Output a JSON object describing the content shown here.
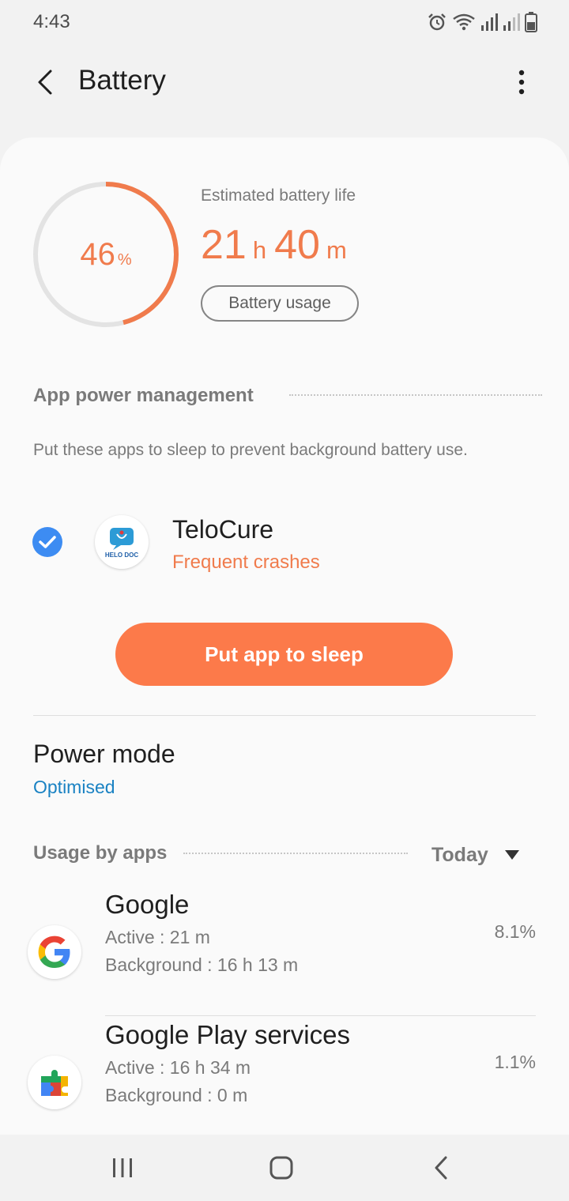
{
  "status_bar": {
    "time": "4:43",
    "icons": [
      "alarm-icon",
      "wifi-icon",
      "signal-icon",
      "signal-icon",
      "battery-icon"
    ]
  },
  "appbar": {
    "title": "Battery",
    "back_icon": "back-arrow-icon",
    "more_icon": "more-vertical-icon"
  },
  "battery": {
    "level_value": "46",
    "level_unit": "%",
    "level_fraction": 0.46,
    "estimated_label": "Estimated battery life",
    "hours": "21",
    "hours_unit": "h",
    "minutes": "40",
    "minutes_unit": "m",
    "usage_button": "Battery usage"
  },
  "app_power": {
    "heading": "App power management",
    "description": "Put these apps to sleep to prevent background battery use.",
    "app": {
      "name": "TeloCure",
      "status": "Frequent crashes",
      "icon_text": "HELO DOC",
      "checked": true
    },
    "button": "Put app to sleep"
  },
  "power_mode": {
    "title": "Power mode",
    "value": "Optimised"
  },
  "usage_by_apps": {
    "heading": "Usage by apps",
    "period": "Today",
    "apps": [
      {
        "name": "Google",
        "active": "Active : 21 m",
        "background": "Background : 16 h 13 m",
        "percent": "8.1%",
        "icon": "google-icon"
      },
      {
        "name": "Google Play services",
        "active": "Active : 16 h 34 m",
        "background": "Background : 0 m",
        "percent": "1.1%",
        "icon": "google-play-services-icon"
      }
    ]
  },
  "colors": {
    "accent_orange": "#fc7a4a",
    "text_orange": "#f07b4c",
    "link_blue": "#1a82c3",
    "check_blue": "#3d8cf2"
  },
  "navbar": {
    "icons": [
      "recent-apps-icon",
      "home-icon",
      "back-icon"
    ]
  }
}
